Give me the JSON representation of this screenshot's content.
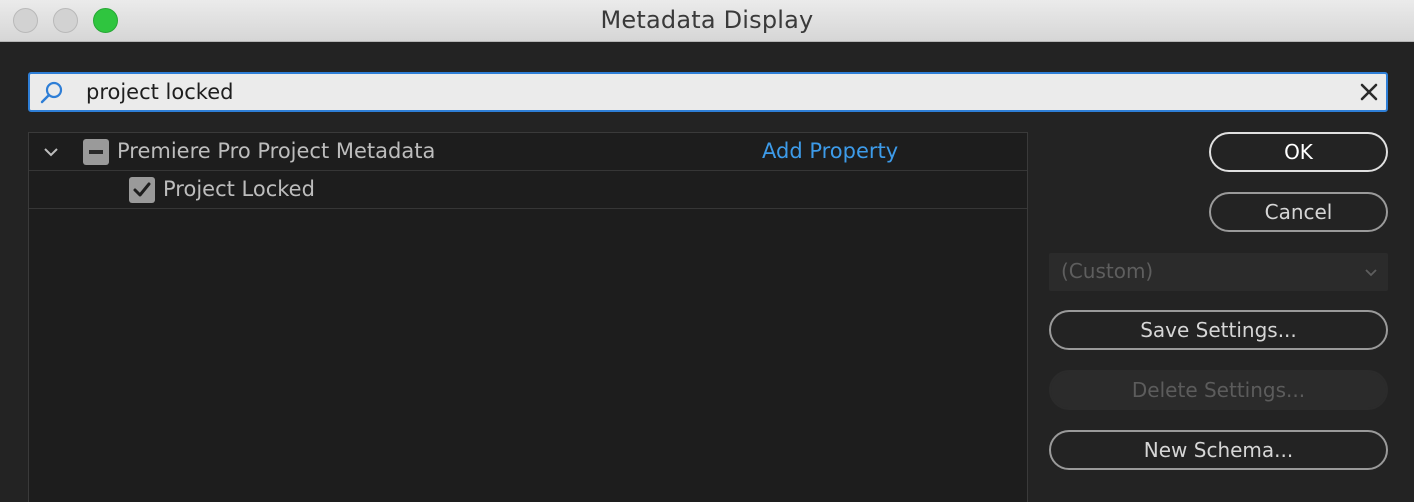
{
  "window": {
    "title": "Metadata Display"
  },
  "search": {
    "value": "project locked",
    "icon": "search-icon"
  },
  "tree": {
    "group": {
      "label": "Premiere Pro Project Metadata",
      "add_property": "Add Property",
      "expanded": true
    },
    "items": [
      {
        "label": "Project Locked",
        "checked": true
      }
    ]
  },
  "buttons": {
    "ok": "OK",
    "cancel": "Cancel",
    "save_settings": "Save Settings...",
    "delete_settings": "Delete Settings...",
    "new_schema": "New Schema..."
  },
  "preset": {
    "selected": "(Custom)"
  },
  "colors": {
    "accent": "#2e7ed6",
    "link": "#3d9be9",
    "background": "#232323"
  }
}
